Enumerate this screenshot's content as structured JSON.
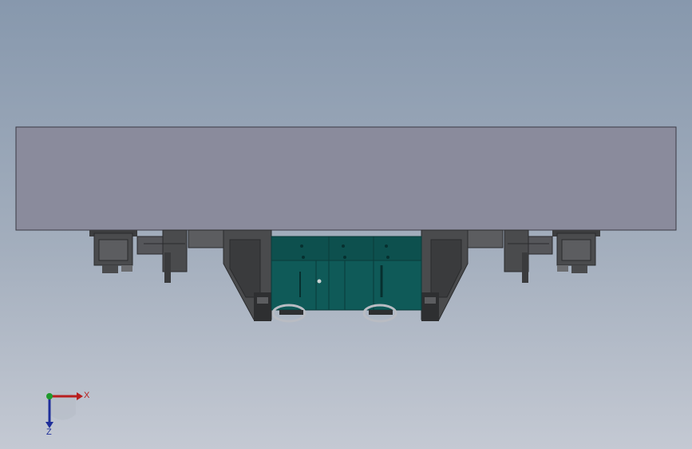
{
  "viewport": {
    "background_top": "#8798ad",
    "background_bottom": "#c4c9d3"
  },
  "model": {
    "body_color": "#8a8b9c",
    "frame_color": "#4a4b4d",
    "frame_dark": "#2e2f31",
    "panel_color": "#0f5a58",
    "panel_dark": "#0a4341",
    "wheel_color": "#b9bcc3"
  },
  "triad": {
    "x_label": "X",
    "z_label": "Z",
    "x_color": "#b81e1e",
    "y_color": "#1f9a2c",
    "z_color": "#1f2f9a"
  }
}
